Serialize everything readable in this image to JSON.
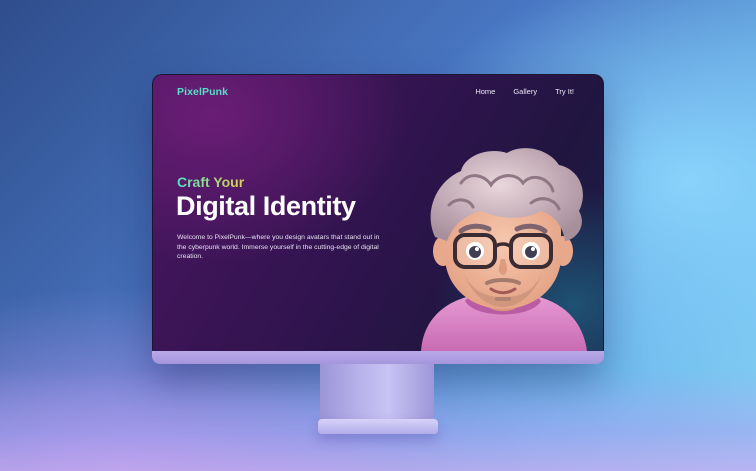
{
  "site": {
    "logo": "PixelPunk",
    "nav": [
      "Home",
      "Gallery",
      "Try It!"
    ]
  },
  "hero": {
    "tagline": "Craft Your",
    "headline": "Digital Identity",
    "description": "Welcome to PixelPunk—where you design avatars that stand out in the cyberpunk world. Immerse yourself in the cutting-edge of digital creation."
  },
  "colors": {
    "accent": "#57e0c6",
    "screen_background": "#351452",
    "avatar_hoodie": "#d884c6"
  }
}
